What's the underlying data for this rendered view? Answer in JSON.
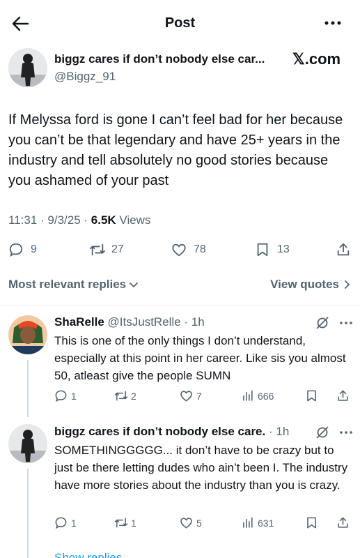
{
  "header": {
    "title": "Post"
  },
  "tweet": {
    "author_name": "biggz cares if don’t nobody else car...",
    "source_badge": "𝕏.com",
    "handle": "@Biggz_91",
    "text": "If Melyssa ford is gone I can’t feel bad for her because you can’t be that legendary and have 25+ years in the industry and tell absolutely no good stories because you ashamed of your past",
    "time": "11:31 · 9/3/25 · ",
    "views_count": "6.5K",
    "views_label": " Views",
    "reply_count": "9",
    "retweet_count": "27",
    "like_count": "78",
    "bookmark_count": "13"
  },
  "replies_bar": {
    "sort_label": "Most relevant replies",
    "quotes_label": "View quotes"
  },
  "replies": [
    {
      "name": "ShaRelle",
      "handle": "@ItsJustRelle",
      "time": "· 1h",
      "text": "This is one of the only things I don’t understand, especially at this point in her career. Like sis you almost 50, atleast give the people SUMN",
      "reply_count": "1",
      "retweet_count": "2",
      "like_count": "7",
      "view_count": "666"
    },
    {
      "name": "biggz cares if don’t nobody else care.",
      "handle": "",
      "time": "· 1h",
      "text": "SOMETHINGGGGG... it don’t have to be crazy but to just be there letting dudes who ain’t been I. The industry have more stories about the industry than you is crazy.",
      "reply_count": "1",
      "retweet_count": "1",
      "like_count": "5",
      "view_count": "631"
    }
  ],
  "show_replies_label": "Show replies",
  "icons": {
    "back": "arrow-left-icon",
    "more": "more-horizontal-icon",
    "reply": "comment-bubble-icon",
    "retweet": "retweet-icon",
    "like": "heart-icon",
    "bookmark": "bookmark-icon",
    "share": "share-icon",
    "views": "bar-chart-icon",
    "grok": "grok-slash-icon",
    "chevron": "chevron-icon"
  },
  "colors": {
    "text": "#0f1419",
    "secondary": "#536471",
    "link": "#1d9bf0",
    "divider": "#eff3f4"
  }
}
